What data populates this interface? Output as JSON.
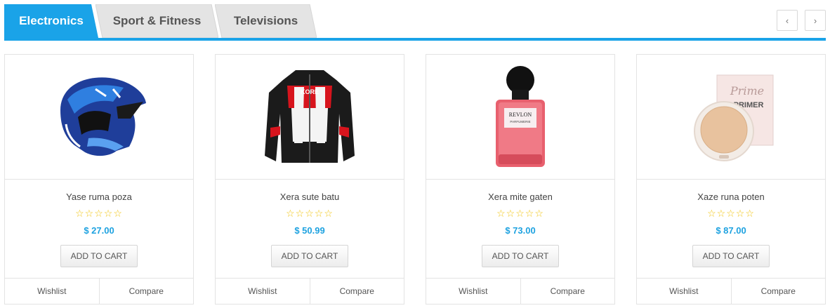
{
  "tabs": [
    {
      "label": "Electronics",
      "active": true
    },
    {
      "label": "Sport & Fitness",
      "active": false
    },
    {
      "label": "Televisions",
      "active": false
    }
  ],
  "nav": {
    "prev_icon": "chevron-left-icon",
    "next_icon": "chevron-right-icon",
    "prev_glyph": "‹",
    "next_glyph": "›"
  },
  "colors": {
    "accent": "#1aa3e8",
    "inactive_tab": "#e4e4e4",
    "price": "#1ea2e0",
    "star": "#f1c40f"
  },
  "products": [
    {
      "name": "Yase ruma poza",
      "price": "$ 27.00",
      "rating": "☆☆☆☆☆",
      "cart_label": "ADD TO CART",
      "wishlist_label": "Wishlist",
      "compare_label": "Compare",
      "image": "helmet"
    },
    {
      "name": "Xera sute batu",
      "price": "$ 50.99",
      "rating": "☆☆☆☆☆",
      "cart_label": "ADD TO CART",
      "wishlist_label": "Wishlist",
      "compare_label": "Compare",
      "image": "jacket"
    },
    {
      "name": "Xera mite gaten",
      "price": "$ 73.00",
      "rating": "☆☆☆☆☆",
      "cart_label": "ADD TO CART",
      "wishlist_label": "Wishlist",
      "compare_label": "Compare",
      "image": "nail-polish"
    },
    {
      "name": "Xaze runa poten",
      "price": "$ 87.00",
      "rating": "☆☆☆☆☆",
      "cart_label": "ADD TO CART",
      "wishlist_label": "Wishlist",
      "compare_label": "Compare",
      "image": "primer-compact"
    }
  ],
  "image_text": {
    "jacket_logo": "KORE",
    "polish_brand": "REVLON",
    "polish_sub": "PARFUMERIE",
    "primer_script": "Prime",
    "primer_title": "PRIMER"
  }
}
